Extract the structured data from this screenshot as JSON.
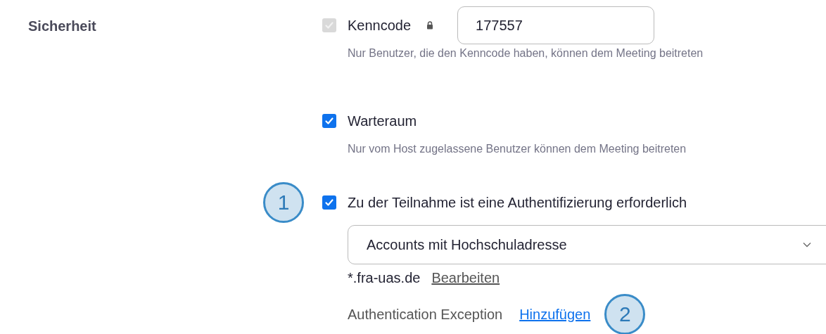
{
  "section_label": "Sicherheit",
  "options": [
    {
      "kind": "passcode",
      "label": "Kenncode",
      "checked": true,
      "disabled": true,
      "value": "177557",
      "description": "Nur Benutzer, die den Kenncode haben, können dem Meeting beitreten"
    },
    {
      "kind": "plain",
      "label": "Warteraum",
      "checked": true,
      "disabled": false,
      "description": "Nur vom Host zugelassene Benutzer können dem Meeting beitreten"
    },
    {
      "kind": "auth",
      "label": "Zu der Teilnahme ist eine Authentifizierung erforderlich",
      "checked": true,
      "disabled": false,
      "callout": "1",
      "select_value": "Accounts mit Hochschuladresse",
      "domain": "*.fra-uas.de",
      "edit_link": "Bearbeiten",
      "exception_label": "Authentication Exception",
      "add_link": "Hinzufügen",
      "add_callout": "2"
    }
  ]
}
